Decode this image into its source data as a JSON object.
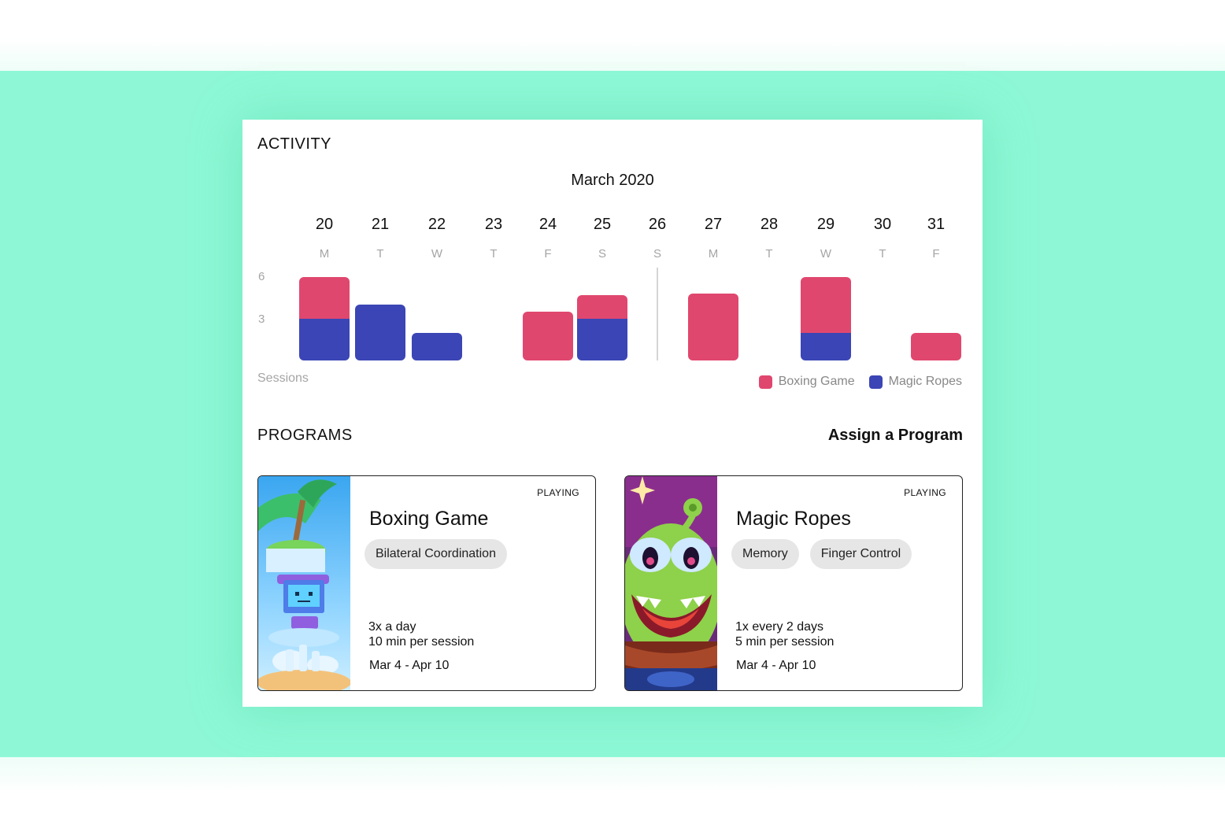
{
  "activity": {
    "section_title": "ACTIVITY",
    "month": "March 2020",
    "days": [
      {
        "date": "20",
        "dow": "M"
      },
      {
        "date": "21",
        "dow": "T"
      },
      {
        "date": "22",
        "dow": "W"
      },
      {
        "date": "23",
        "dow": "T"
      },
      {
        "date": "24",
        "dow": "F"
      },
      {
        "date": "25",
        "dow": "S"
      },
      {
        "date": "26",
        "dow": "S"
      },
      {
        "date": "27",
        "dow": "M"
      },
      {
        "date": "28",
        "dow": "T"
      },
      {
        "date": "29",
        "dow": "W"
      },
      {
        "date": "30",
        "dow": "T"
      },
      {
        "date": "31",
        "dow": "F"
      }
    ],
    "y_ticks": [
      "6",
      "3"
    ],
    "y_axis_label": "Sessions",
    "legend": [
      {
        "label": "Boxing Game",
        "color": "#e0476e"
      },
      {
        "label": "Magic Ropes",
        "color": "#3b45b5"
      }
    ]
  },
  "chart_data": {
    "type": "bar",
    "stacked": true,
    "categories": [
      "20",
      "21",
      "22",
      "23",
      "24",
      "25",
      "26",
      "27",
      "28",
      "29",
      "30",
      "31"
    ],
    "series": [
      {
        "name": "Magic Ropes",
        "color": "#3b45b5",
        "values": [
          3,
          4,
          2,
          0,
          0,
          3,
          0,
          0,
          0,
          2,
          0,
          0
        ]
      },
      {
        "name": "Boxing Game",
        "color": "#e0476e",
        "values": [
          3,
          0,
          0,
          0,
          3.5,
          1.7,
          0,
          4.8,
          0,
          4,
          0,
          2
        ]
      }
    ],
    "ylim": [
      0,
      6
    ],
    "ylabel": "Sessions",
    "grid": false,
    "legend_position": "bottom-right"
  },
  "programs": {
    "section_title": "PROGRAMS",
    "assign_label": "Assign a Program",
    "cards": [
      {
        "status": "PLAYING",
        "title": "Boxing Game",
        "tags": [
          "Bilateral Coordination"
        ],
        "frequency": "3x a day",
        "duration": "10 min per session",
        "date_range": "Mar 4 - Apr 10"
      },
      {
        "status": "PLAYING",
        "title": "Magic Ropes",
        "tags": [
          "Memory",
          "Finger Control"
        ],
        "frequency": "1x every 2 days",
        "duration": "5 min per session",
        "date_range": "Mar 4 - Apr 10"
      }
    ]
  }
}
